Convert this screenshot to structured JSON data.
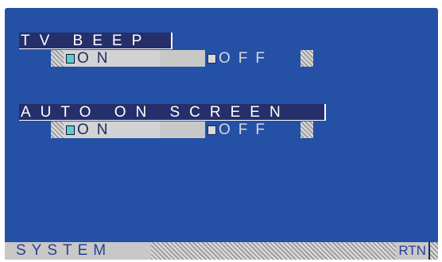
{
  "tv_beep": {
    "title": "TV BEEP",
    "on_label": "ON",
    "off_label": "OFF",
    "selected": "ON"
  },
  "auto_on_screen": {
    "title": "AUTO ON SCREEN",
    "on_label": "ON",
    "off_label": "OFF",
    "selected": "ON"
  },
  "footer": {
    "menu_label": "SYSTEM",
    "return_label": "RTN"
  },
  "colors": {
    "background": "#2450a6",
    "title_bar": "#252f6a",
    "checked_box": "#62cbc9",
    "bar": "#c8c8c8"
  }
}
